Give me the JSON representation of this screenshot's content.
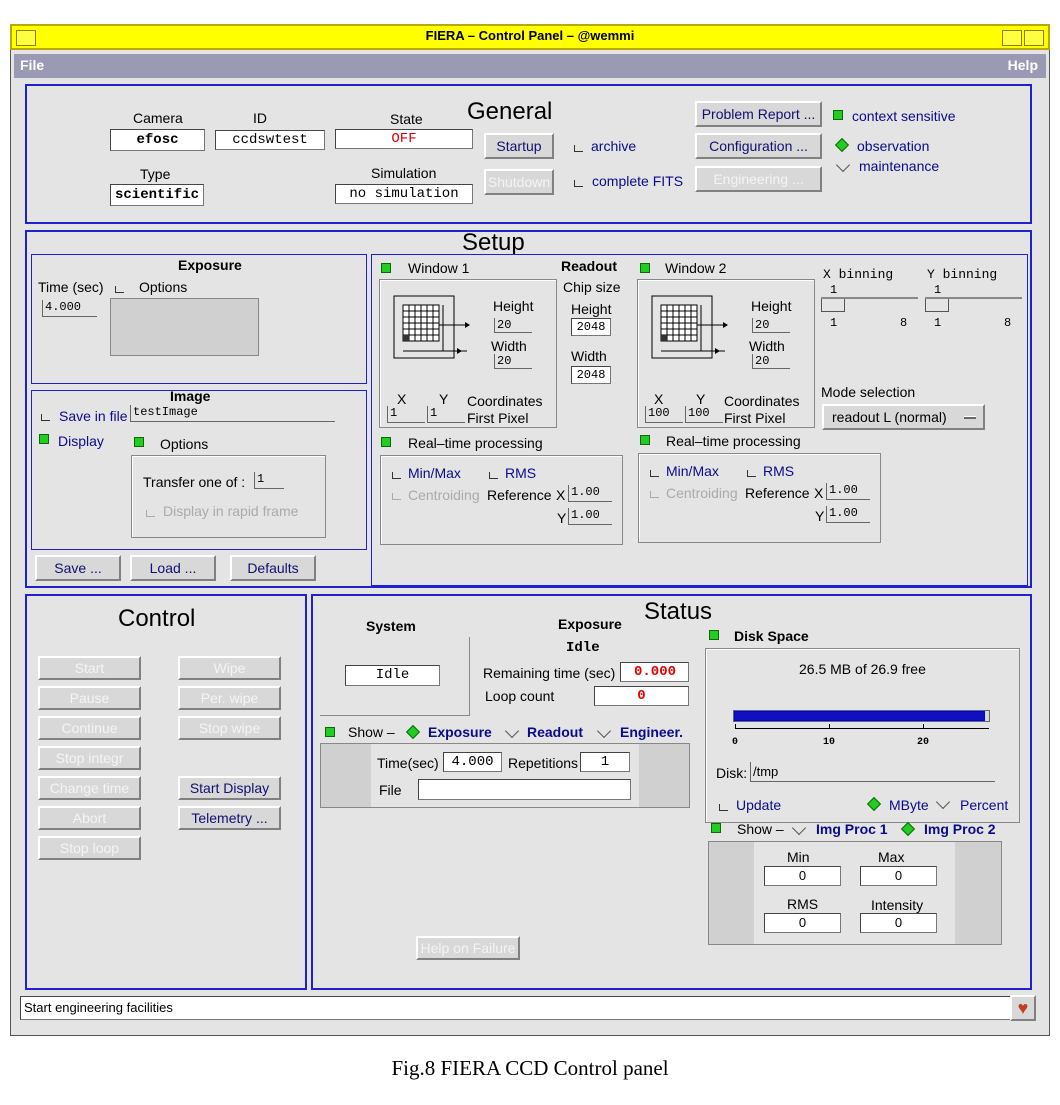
{
  "window": {
    "title": "FIERA – Control Panel – @wemmi",
    "menu_file": "File",
    "menu_help": "Help"
  },
  "general": {
    "title": "General",
    "camera_label": "Camera",
    "camera_value": "efosc",
    "id_label": "ID",
    "id_value": "ccdswtest",
    "state_label": "State",
    "state_value": "OFF",
    "type_label": "Type",
    "type_value": "scientific",
    "simulation_label": "Simulation",
    "simulation_value": "no simulation",
    "startup": "Startup",
    "shutdown": "Shutdown",
    "archive": "archive",
    "complete_fits": "complete FITS",
    "problem_report": "Problem Report ...",
    "configuration": "Configuration ...",
    "engineering": "Engineering ...",
    "context_sensitive": "context sensitive",
    "observation": "observation",
    "maintenance": "maintenance"
  },
  "setup": {
    "title": "Setup",
    "exposure": {
      "title": "Exposure",
      "time_label": "Time (sec)",
      "time_value": "4.000",
      "options": "Options"
    },
    "image": {
      "title": "Image",
      "save_in_file": "Save in file",
      "file_value": "testImage",
      "display": "Display",
      "options": "Options",
      "transfer_label": "Transfer one of :",
      "transfer_value": "1",
      "rapid_frame": "Display in rapid frame"
    },
    "buttons": {
      "save": "Save ...",
      "load": "Load ...",
      "defaults": "Defaults"
    },
    "readout": {
      "title": "Readout",
      "chip_size": "Chip size",
      "height_label": "Height",
      "height_value": "2048",
      "width_label": "Width",
      "width_value": "2048"
    },
    "window1": {
      "label": "Window 1",
      "height_label": "Height",
      "height_value": "20",
      "width_label": "Width",
      "width_value": "20",
      "x_label": "X",
      "y_label": "Y",
      "x_value": "1",
      "y_value": "1",
      "coord_label": "Coordinates",
      "first_pixel": "First Pixel"
    },
    "window2": {
      "label": "Window 2",
      "height_label": "Height",
      "height_value": "20",
      "width_label": "Width",
      "width_value": "20",
      "x_label": "X",
      "y_label": "Y",
      "x_value": "100",
      "y_value": "100",
      "coord_label": "Coordinates",
      "first_pixel": "First Pixel"
    },
    "rtp1": {
      "label": "Real–time processing",
      "minmax": "Min/Max",
      "rms": "RMS",
      "centroiding": "Centroiding",
      "reference": "Reference",
      "x": "X",
      "y": "Y",
      "x_value": "1.00",
      "y_value": "1.00"
    },
    "rtp2": {
      "label": "Real–time processing",
      "minmax": "Min/Max",
      "rms": "RMS",
      "centroiding": "Centroiding",
      "reference": "Reference",
      "x": "X",
      "y": "Y",
      "x_value": "1.00",
      "y_value": "1.00"
    },
    "binning": {
      "x_label": "X binning",
      "y_label": "Y binning",
      "x_value": "1",
      "y_value": "1",
      "x_min": "1",
      "x_max": "8",
      "y_min": "1",
      "y_max": "8"
    },
    "mode": {
      "label": "Mode selection",
      "value": "readout L (normal)"
    }
  },
  "control": {
    "title": "Control",
    "start": "Start",
    "pause": "Pause",
    "continue": "Continue",
    "stop_integr": "Stop integr",
    "change_time": "Change time",
    "abort": "Abort",
    "stop_loop": "Stop loop",
    "wipe": "Wipe",
    "per_wipe": "Per. wipe",
    "stop_wipe": "Stop wipe",
    "start_display": "Start Display",
    "telemetry": "Telemetry ...",
    "help_failure": "Help on Failure"
  },
  "status": {
    "title": "Status",
    "system_label": "System",
    "system_value": "Idle",
    "exposure_label": "Exposure",
    "exposure_value": "Idle",
    "remaining_label": "Remaining time (sec)",
    "remaining_value": "0.000",
    "loop_label": "Loop count",
    "loop_value": "0",
    "show": "Show –",
    "tab_exposure": "Exposure",
    "tab_readout": "Readout",
    "tab_engineer": "Engineer.",
    "time_label": "Time(sec)",
    "time_value": "4.000",
    "rep_label": "Repetitions",
    "rep_value": "1",
    "file_label": "File",
    "file_value": "",
    "disk": {
      "title": "Disk Space",
      "summary": "26.5 MB of 26.9 free",
      "fill_fraction": 0.985,
      "ticks": [
        "0",
        "10",
        "20"
      ],
      "disk_label": "Disk:",
      "disk_value": "/tmp",
      "update": "Update",
      "mbyte": "MByte",
      "percent": "Percent"
    },
    "imgproc": {
      "show": "Show –",
      "proc1": "Img Proc 1",
      "proc2": "Img Proc 2",
      "min_label": "Min",
      "min_value": "0",
      "max_label": "Max",
      "max_value": "0",
      "rms_label": "RMS",
      "rms_value": "0",
      "int_label": "Intensity",
      "int_value": "0"
    }
  },
  "statusbar": {
    "message": "Start engineering facilities"
  },
  "caption": "Fig.8 FIERA CCD Control panel"
}
